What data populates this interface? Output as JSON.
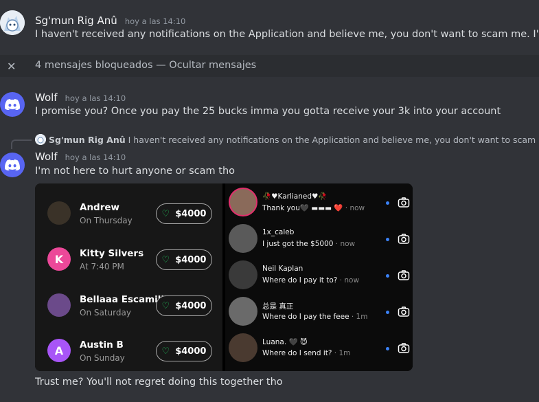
{
  "messages": {
    "m1": {
      "username": "Sg'mun Rig Anû",
      "timestamp": "hoy a las 14:10",
      "text": "I haven't received any notifications on the Application and believe me, you don't want to scam me. I'm a lawye"
    },
    "blocked": {
      "text": "4 mensajes bloqueados — ",
      "link": "Ocultar mensajes"
    },
    "m2": {
      "username": "Wolf",
      "timestamp": "hoy a las 14:10",
      "text": "I promise you? Once you pay the 25 bucks imma you gotta receive your 3k into your account"
    },
    "m3": {
      "reply_name": "Sg'mun Rig Anû",
      "reply_text": "I haven't received any notifications on the Application and believe me, you don't want to scam me. I'm a la",
      "username": "Wolf",
      "timestamp": "hoy a las 14:10",
      "text": "I'm not here to hurt anyone or scam tho",
      "followup": "Trust me? You'll not regret doing this together tho"
    }
  },
  "payments": [
    {
      "name": "Andrew",
      "sub": "On Thursday",
      "amount": "$4000",
      "initial": "",
      "color": "#3a3228"
    },
    {
      "name": "Kitty Silvers",
      "sub": "At 7:40 PM",
      "amount": "$4000",
      "initial": "K",
      "color": "#ec4899"
    },
    {
      "name": "Bellaaa Escamillla",
      "sub": "On Saturday",
      "amount": "$4000",
      "initial": "",
      "color": "#6b4a8a"
    },
    {
      "name": "Austin B",
      "sub": "On Sunday",
      "amount": "$4000",
      "initial": "A",
      "color": "#a855f7"
    }
  ],
  "dms": [
    {
      "name": "🥀♥Karlianed♥🥀",
      "text": "Thank you🖤 ▬▬▬ ❤️",
      "time": " · now",
      "color": "#8a6a5a"
    },
    {
      "name": "1x_caleb",
      "text": "I just got the $5000",
      "time": " · now",
      "color": "#5a5a5a"
    },
    {
      "name": "Neil Kaplan",
      "text": "Where do I pay it to?",
      "time": " · now",
      "color": "#3a3a3a"
    },
    {
      "name": "总是 真正",
      "text": "Where do I pay the feee",
      "time": " · 1m",
      "color": "#6a6a6a"
    },
    {
      "name": "Luana. 🖤 😈",
      "text": "Where do I send it?",
      "time": " · 1m",
      "color": "#4a3a30"
    }
  ],
  "colors": {
    "accent": "#5865f2",
    "heart": "#21c55d",
    "unread": "#3b82f6"
  }
}
